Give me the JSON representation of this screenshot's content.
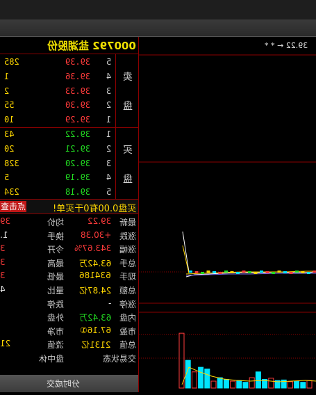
{
  "stock_name": "000792 盐湖股份",
  "order_book": {
    "sell": [
      {
        "level": "5",
        "price": "39.39",
        "volume": "285"
      },
      {
        "level": "4",
        "price": "39.36",
        "volume": "1"
      },
      {
        "level": "3",
        "price": "39.33",
        "volume": "2"
      },
      {
        "level": "2",
        "price": "39.30",
        "volume": "55"
      },
      {
        "level": "1",
        "price": "39.29",
        "volume": "10"
      }
    ],
    "buy": [
      {
        "level": "1",
        "price": "39.22",
        "volume": "43"
      },
      {
        "level": "2",
        "price": "39.21",
        "volume": "20"
      },
      {
        "level": "3",
        "price": "39.20",
        "volume": "328"
      },
      {
        "level": "4",
        "price": "39.19",
        "volume": "5"
      },
      {
        "level": "5",
        "price": "39.18",
        "volume": "234"
      }
    ],
    "sell_label_1": "卖",
    "sell_label_2": "盘",
    "buy_label_1": "买",
    "buy_label_2": "盘"
  },
  "strip": {
    "text": "买盘0.00有0千买单!",
    "button": "点击查"
  },
  "quote_rows": [
    {
      "l1": "最新",
      "v1": "39.22",
      "l2": "均价",
      "v2": "39",
      "c1": "#ff3b3b",
      "c2": "#ff3b3b"
    },
    {
      "l1": "涨跌",
      "v1": "+30.38",
      "l2": "换手",
      "v2": "1.",
      "c1": "#ff3b3b",
      "c2": "#e0e0e0"
    },
    {
      "l1": "涨幅",
      "v1": "343.67%",
      "l2": "今开",
      "v2": "3",
      "c1": "#ff3b3b",
      "c2": "#ff3b3b"
    },
    {
      "l1": "总手",
      "v1": "63.42万",
      "l2": "最高",
      "v2": "3",
      "c1": "#ffd700",
      "c2": "#ff3b3b"
    },
    {
      "l1": "现手",
      "v1": "634186",
      "l2": "最低",
      "v2": "3",
      "c1": "#ffd700",
      "c2": "#ff3b3b"
    },
    {
      "l1": "总额",
      "v1": "24.87亿",
      "l2": "量比",
      "v2": "4",
      "c1": "#ffd700",
      "c2": "#e0e0e0"
    },
    {
      "l1": "涨停",
      "v1": "-",
      "l2": "跌停",
      "v2": "",
      "c1": "#e0e0e0",
      "c2": "#e0e0e0"
    },
    {
      "l1": "内盘",
      "v1": "63.42万",
      "l2": "外盘",
      "v2": "",
      "c1": "#22dd22",
      "c2": "#ff3b3b"
    },
    {
      "l1": "市盈",
      "v1": "67.16①",
      "l2": "市净",
      "v2": "",
      "c1": "#ffd700",
      "c2": "#ffd700"
    },
    {
      "l1": "总值",
      "v1": "2131亿",
      "l2": "流值",
      "v2": "21",
      "c1": "#ffd700",
      "c2": "#ffd700"
    },
    {
      "l1": "交易状态",
      "v1": "",
      "l2": "盘中休",
      "v2": "",
      "c1": "#e0e0e0",
      "c2": "#e0e0e0"
    }
  ],
  "bottom_tab": "分时成交",
  "chart_price_label": "39.22 ← * *",
  "chart_data": {
    "type": "line",
    "volume_bars": [
      0.95,
      0.48,
      0.28,
      0.36,
      0.33,
      0.12,
      0.18,
      0.15,
      0.12,
      0.13,
      0.1,
      0.18,
      0.28,
      0.15,
      0.17,
      0.13,
      0.14,
      0.11,
      0.12,
      0.1,
      0.13
    ]
  }
}
